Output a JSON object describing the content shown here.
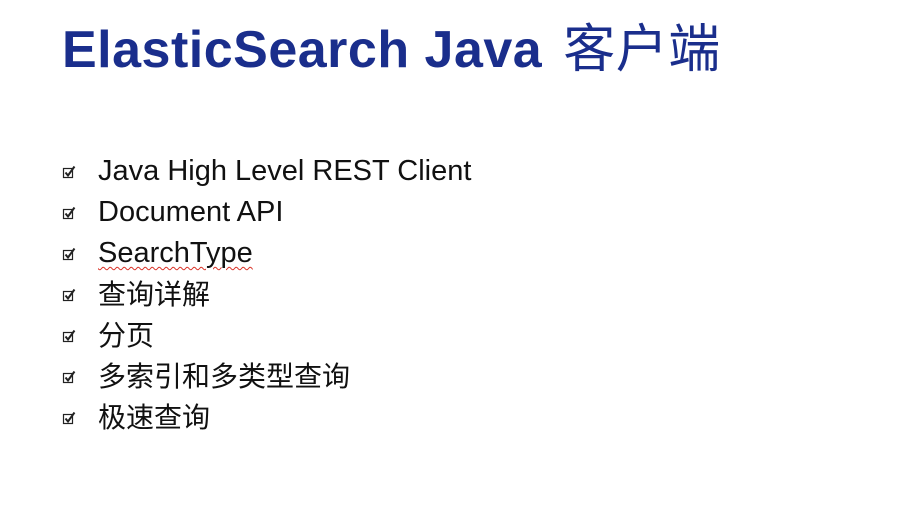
{
  "slide": {
    "title_latin": "ElasticSearch Java",
    "title_cjk": "客户端",
    "title_color": "#1a2e8c",
    "bullet_icon": "checkbox-checked-icon",
    "items": [
      {
        "label": "Java High Level REST Client"
      },
      {
        "label": "Document API"
      },
      {
        "label": "SearchType",
        "spellcheck_underline": true
      },
      {
        "label": "查询详解"
      },
      {
        "label": "分页"
      },
      {
        "label": "多索引和多类型查询"
      },
      {
        "label": "极速查询"
      }
    ]
  }
}
